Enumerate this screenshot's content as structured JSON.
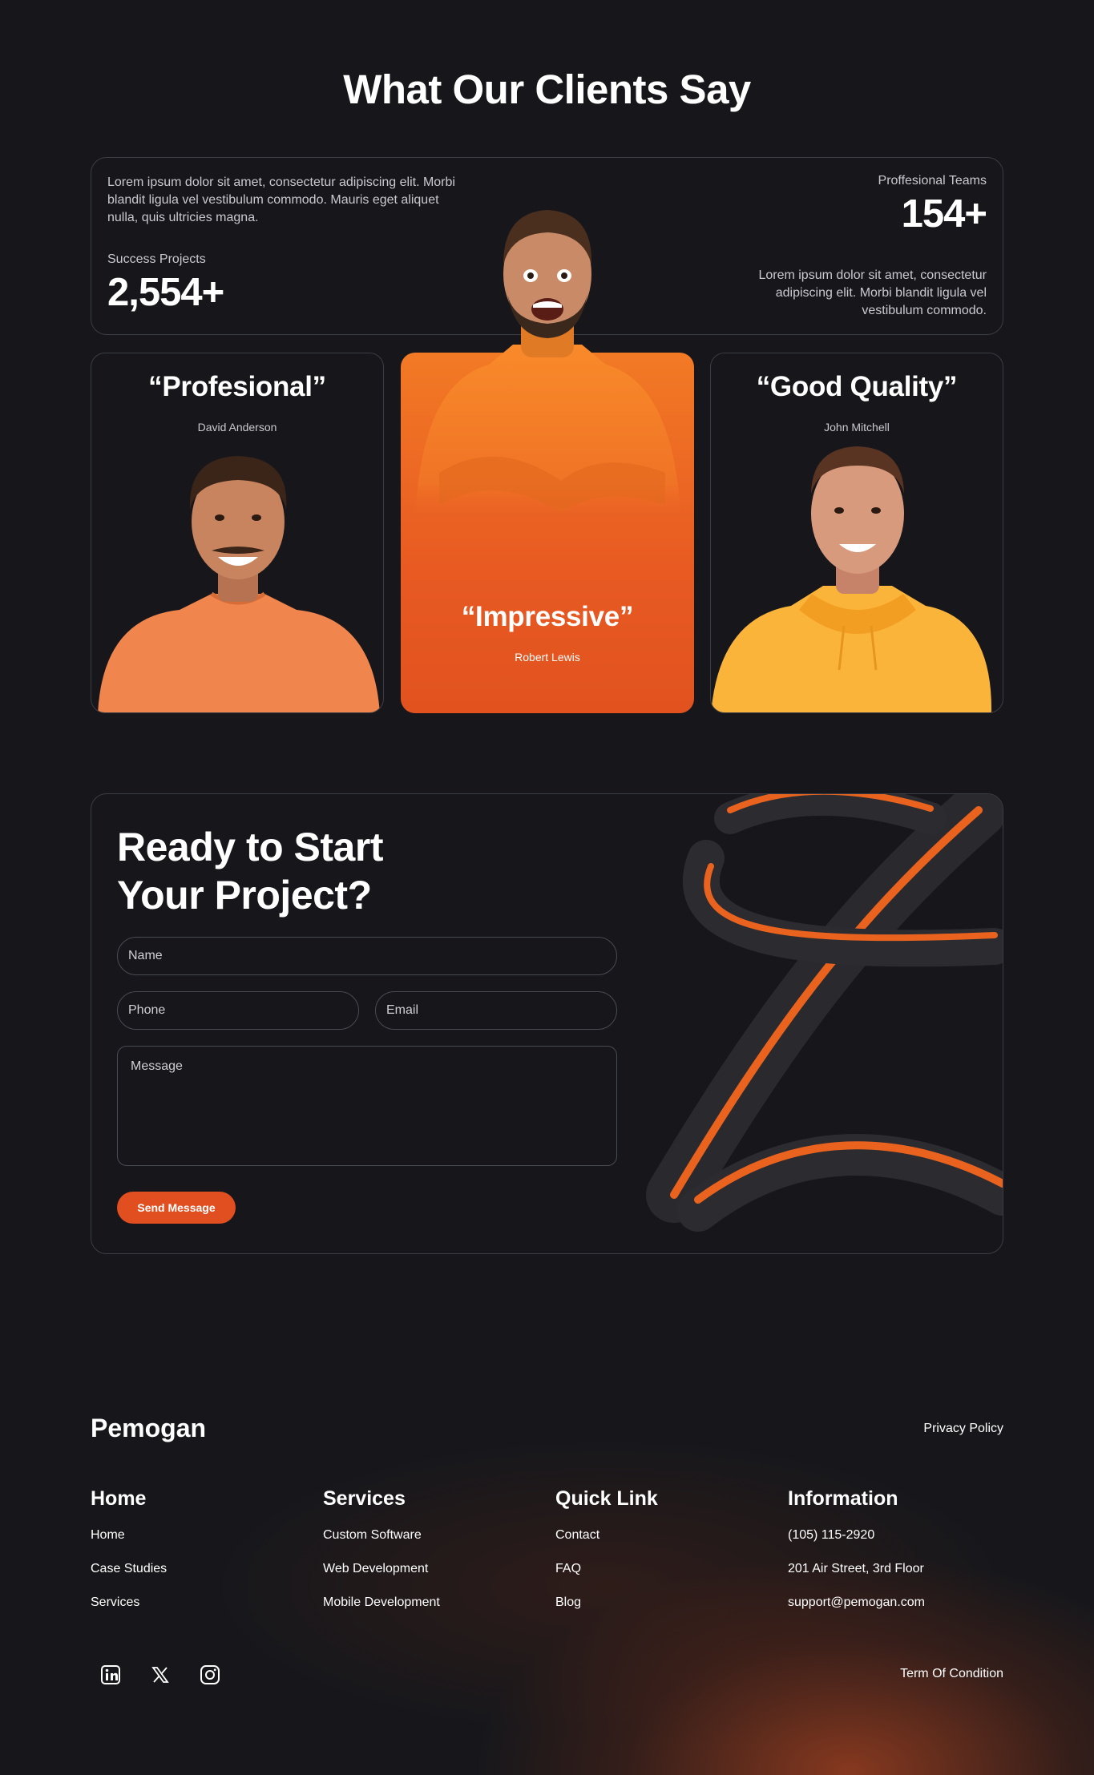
{
  "testimonials": {
    "heading": "What Our Clients Say",
    "stats": {
      "left_text": "Lorem ipsum dolor sit amet, consectetur adipiscing elit. Morbi blandit ligula vel vestibulum commodo. Mauris eget aliquet nulla, quis ultricies magna.",
      "left_label": "Success Projects",
      "left_value": "2,554+",
      "right_label": "Proffesional Teams",
      "right_value": "154+",
      "right_text": "Lorem ipsum dolor sit amet, consectetur adipiscing elit. Morbi blandit ligula vel vestibulum commodo."
    },
    "cards": [
      {
        "quote": "“Profesional”",
        "name": "David Anderson"
      },
      {
        "quote": "“Impressive”",
        "name": "Robert Lewis"
      },
      {
        "quote": "“Good Quality”",
        "name": "John Mitchell"
      }
    ]
  },
  "cta": {
    "heading_line1": "Ready to Start",
    "heading_line2": "Your Project?",
    "name_placeholder": "Name",
    "phone_placeholder": "Phone",
    "email_placeholder": "Email",
    "message_placeholder": "Message",
    "send_label": "Send Message"
  },
  "footer": {
    "brand": "Pemogan",
    "privacy": "Privacy Policy",
    "terms": "Term Of Condition",
    "columns": [
      {
        "title": "Home",
        "links": [
          "Home",
          "Case Studies",
          "Services"
        ]
      },
      {
        "title": "Services",
        "links": [
          "Custom Software",
          "Web Development",
          "Mobile Development"
        ]
      },
      {
        "title": "Quick Link",
        "links": [
          "Contact",
          "FAQ",
          "Blog"
        ]
      },
      {
        "title": "Information",
        "links": [
          "(105) 115-2920",
          "201 Air Street, 3rd Floor",
          "support@pemogan.com"
        ]
      }
    ],
    "social_icons": [
      "linkedin-icon",
      "x-icon",
      "instagram-icon"
    ]
  },
  "colors": {
    "accent": "#e14f20",
    "background": "#17171b",
    "border": "#3c3c43"
  }
}
